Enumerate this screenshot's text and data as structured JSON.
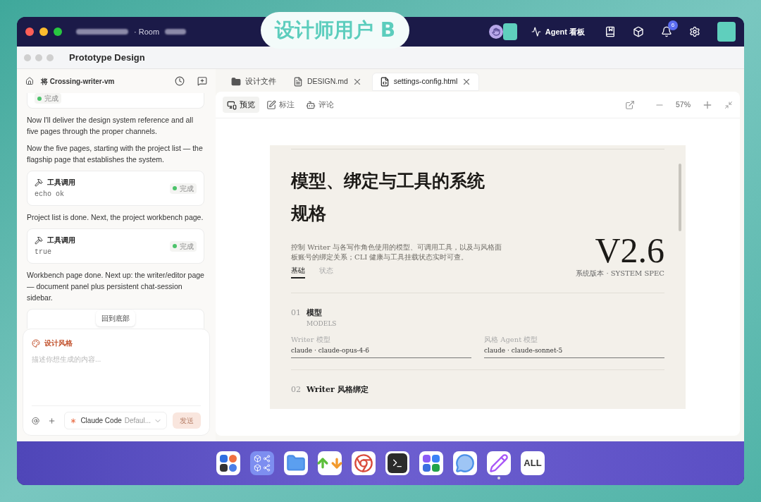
{
  "top_bar": {
    "room_label": "· Room",
    "agent_button": "Agent 看板",
    "notification_count": "6"
  },
  "overlay_label": "设计师用户 B",
  "window_title": "Prototype Design",
  "sidebar": {
    "title": "将 Crossing-writer-vm",
    "messages": [
      {
        "kind": "status",
        "status": "完成"
      },
      {
        "kind": "text",
        "text": "Now I'll deliver the design system reference and all five pages through the proper channels."
      },
      {
        "kind": "text",
        "text": "Now the five pages, starting with the project list — the flagship page that establishes the system."
      },
      {
        "kind": "tool",
        "title": "工具调用",
        "command": "echo ok",
        "status": "完成"
      },
      {
        "kind": "text",
        "text": "Project list is done. Next, the project workbench page."
      },
      {
        "kind": "tool",
        "title": "工具调用",
        "command": "true",
        "status": "完成"
      },
      {
        "kind": "text",
        "text": "Workbench page done. Next up: the writer/editor page — document panel plus persistent chat-session sidebar."
      },
      {
        "kind": "peek"
      }
    ],
    "scroll_to_bottom": "回到底部",
    "composer": {
      "tag": "设计风格",
      "placeholder": "描述你想生成的内容...",
      "agent": "Claude Code",
      "mode": "Defaul...",
      "send": "发送",
      "send_disabled": true
    }
  },
  "tabs": [
    {
      "kind": "folder",
      "label": "设计文件",
      "closable": false,
      "selected": false
    },
    {
      "kind": "file",
      "label": "DESIGN.md",
      "closable": true,
      "selected": false
    },
    {
      "kind": "html",
      "label": "settings-config.html",
      "closable": true,
      "selected": true
    }
  ],
  "modes": [
    {
      "kind": "preview",
      "label": "预览",
      "selected": true
    },
    {
      "kind": "annotate",
      "label": "标注",
      "selected": false
    },
    {
      "kind": "comment",
      "label": "评论",
      "selected": false
    }
  ],
  "zoom": "57%",
  "document": {
    "title_lines": [
      "模型、绑定与工具的系统",
      "规格"
    ],
    "description": "控制 Writer 与各写作角色使用的模型、可调用工具，以及与风格面板账号的绑定关系；CLI 健康与工具挂载状态实时可查。",
    "tabs": [
      {
        "label": "基础",
        "selected": true
      },
      {
        "label": "状态",
        "selected": false
      }
    ],
    "version": "V2.6",
    "version_caption": "系统版本 · SYSTEM SPEC",
    "sections": [
      {
        "number": "01",
        "title": "模型",
        "subtitle": "MODELS",
        "fields": [
          {
            "label": "Writer 模型",
            "value": "claude · claude-opus-4-6"
          },
          {
            "label": "风格 Agent 模型",
            "value": "claude · claude-sonnet-5"
          }
        ]
      },
      {
        "number": "02",
        "title": "Writer 风格绑定"
      }
    ]
  },
  "dock": [
    {
      "kind": "cluster",
      "running": false
    },
    {
      "kind": "cluster2",
      "running": false
    },
    {
      "kind": "folder",
      "running": false
    },
    {
      "kind": "transfer",
      "running": false
    },
    {
      "kind": "browser",
      "running": false
    },
    {
      "kind": "terminal",
      "running": false
    },
    {
      "kind": "grid",
      "running": false
    },
    {
      "kind": "chat",
      "running": false
    },
    {
      "kind": "design",
      "running": true
    },
    {
      "kind": "all",
      "label": "ALL",
      "running": false
    }
  ]
}
